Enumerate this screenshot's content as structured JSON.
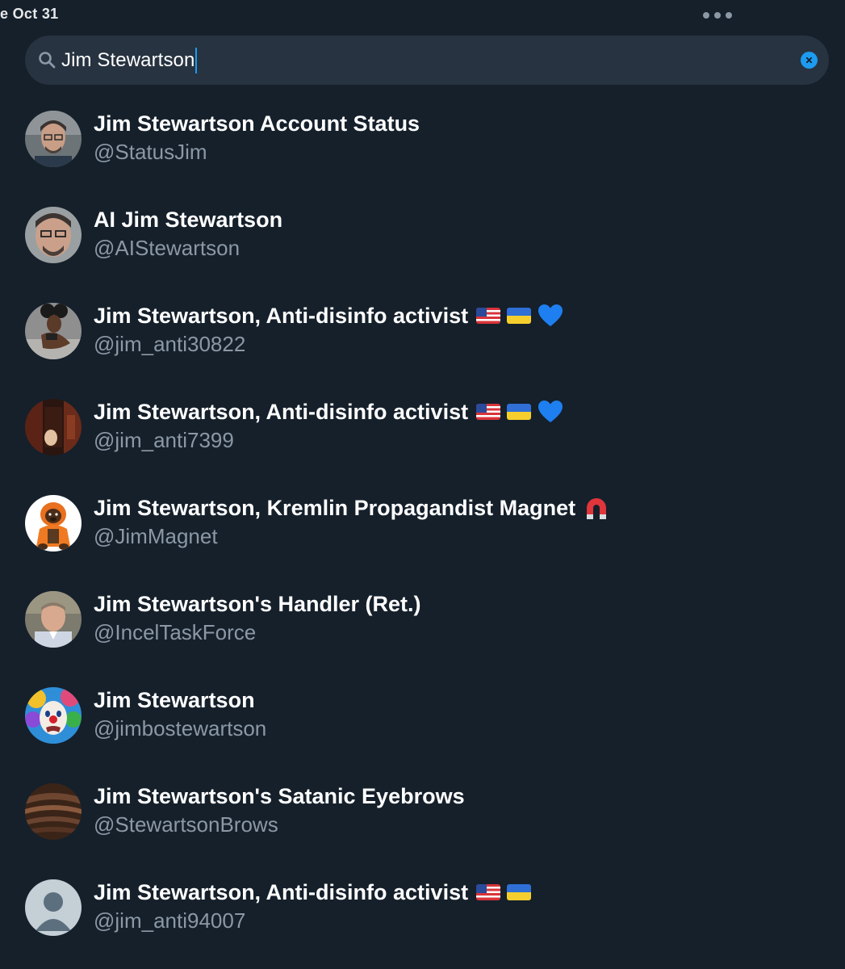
{
  "status_bar": {
    "date": "e Oct 31",
    "more_icon": "more-dots-icon"
  },
  "search": {
    "query": "Jim Stewartson",
    "search_icon": "search-icon",
    "clear_icon": "clear-icon"
  },
  "colors": {
    "background": "#15202b",
    "search_bg": "#273340",
    "accent": "#1d9bf0",
    "secondary_text": "#8b98a5"
  },
  "results": [
    {
      "name": "Jim Stewartson Account Status",
      "handle": "@StatusJim",
      "emojis": []
    },
    {
      "name": "AI Jim Stewartson",
      "handle": "@AIStewartson",
      "emojis": []
    },
    {
      "name": "Jim Stewartson, Anti-disinfo activist",
      "handle": "@jim_anti30822",
      "emojis": [
        "us-flag",
        "ukraine-flag",
        "blue-heart"
      ]
    },
    {
      "name": "Jim Stewartson, Anti-disinfo activist",
      "handle": "@jim_anti7399",
      "emojis": [
        "us-flag",
        "ukraine-flag",
        "blue-heart"
      ]
    },
    {
      "name": "Jim Stewartson, Kremlin Propagandist Magnet",
      "handle": "@JimMagnet",
      "emojis": [
        "magnet"
      ]
    },
    {
      "name": "Jim Stewartson's Handler (Ret.)",
      "handle": "@IncelTaskForce",
      "emojis": []
    },
    {
      "name": "Jim Stewartson",
      "handle": "@jimbostewartson",
      "emojis": []
    },
    {
      "name": "Jim Stewartson's Satanic Eyebrows",
      "handle": "@StewartsonBrows",
      "emojis": []
    },
    {
      "name": "Jim Stewartson, Anti-disinfo activist",
      "handle": "@jim_anti94007",
      "emojis": [
        "us-flag",
        "ukraine-flag"
      ]
    }
  ]
}
